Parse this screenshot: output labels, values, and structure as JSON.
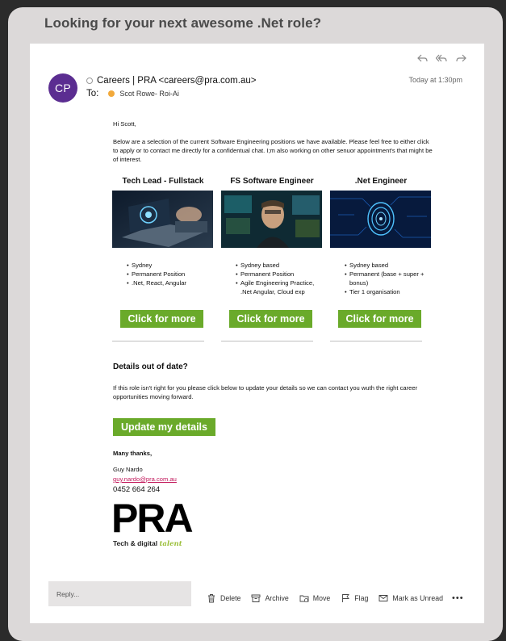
{
  "headline": "Looking for your next awesome .Net role?",
  "message": {
    "avatar_initials": "CP",
    "from": "Careers | PRA <careers@pra.com.au>",
    "to_label": "To:",
    "to_name": "Scot Rowe- Roi-Ai",
    "time": "Today at 1:30pm",
    "top_actions": [
      "reply-icon",
      "reply-all-icon",
      "forward-icon"
    ]
  },
  "body": {
    "greeting": "Hi Scott,",
    "intro": "Below are a selection of the current Software Engineering positions we have available. Please feel free to either click to apply or to contact me directly for a confidentual chat. I;m also working on other senuor appointment's that might be of interest."
  },
  "jobs": [
    {
      "title": "Tech Lead - Fullstack",
      "bullets": [
        "Sydney",
        "Permanent Position",
        ".Net, React, Angular"
      ],
      "cta": "Click for more"
    },
    {
      "title": "FS Software Engineer",
      "bullets": [
        "Sydney based",
        "Permanent Position",
        "Agile Engineering Practice, .Net Angular, Cloud exp"
      ],
      "cta": "Click for more"
    },
    {
      "title": ".Net Engineer",
      "bullets": [
        "Sydney based",
        "Permanent (base + super + bonus)",
        "Tier 1 organisation"
      ],
      "cta": "Click for more"
    }
  ],
  "details": {
    "heading": "Details out of date?",
    "text": "If this role isn't right for you please click below to update your details so we can contact you wuth the right career opportunities moving forward.",
    "button": "Update my details"
  },
  "signature": {
    "thanks": "Many thanks,",
    "name": "Guy Nardo",
    "email": "guy.nardo@pra.com.au",
    "phone": "0452 664 264",
    "logo": "PRA",
    "tagline": "Tech & digital",
    "tagline_accent": "talent"
  },
  "footer": {
    "reply_placeholder": "Reply...",
    "actions": {
      "delete": "Delete",
      "archive": "Archive",
      "move": "Move",
      "flag": "Flag",
      "mark_unread": "Mark as Unread",
      "more": "•••"
    }
  },
  "colors": {
    "accent_green": "#6aaa2a",
    "avatar_purple": "#5b2d91",
    "link_pink": "#c2185b"
  }
}
